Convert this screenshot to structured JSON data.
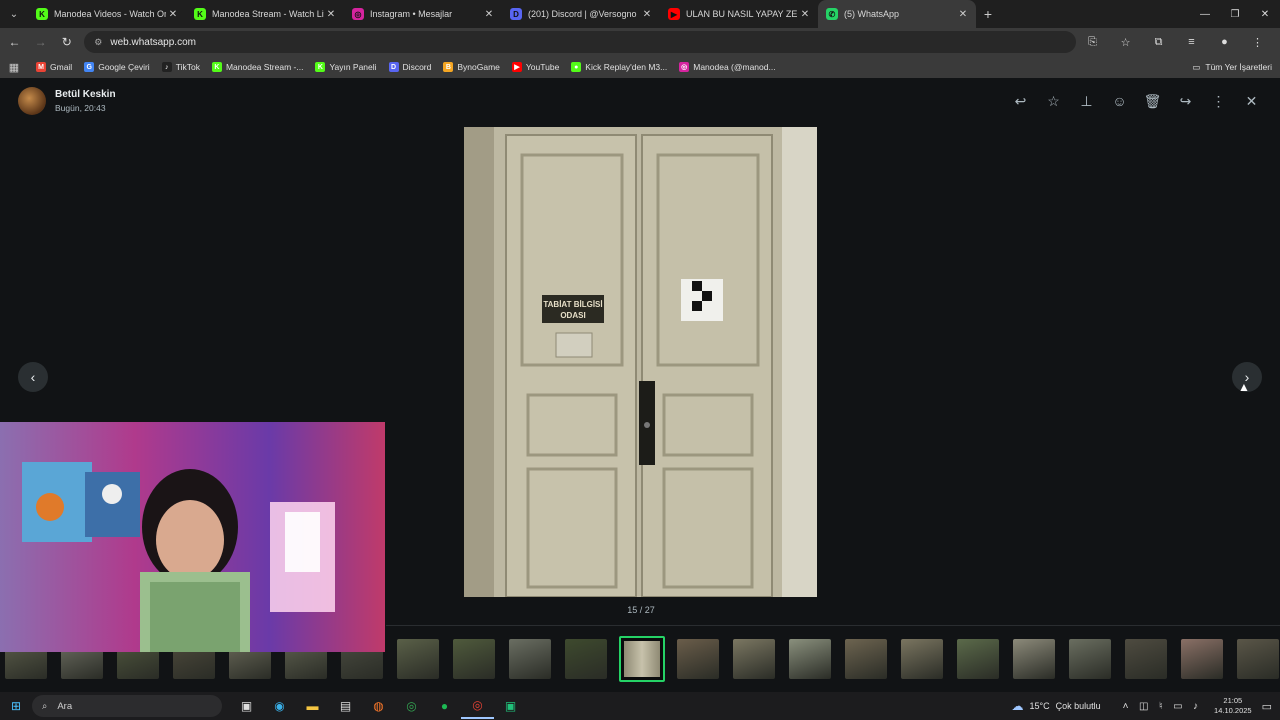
{
  "browser": {
    "tabs": [
      {
        "title": "Manodea Videos - Watch On-D",
        "icon": "kick-icon",
        "color": "#53fc18",
        "glyph": "K"
      },
      {
        "title": "Manodea Stream - Watch Live",
        "icon": "kick-icon",
        "color": "#53fc18",
        "glyph": "K"
      },
      {
        "title": "Instagram • Mesajlar",
        "icon": "instagram-icon",
        "color": "#d6249f",
        "glyph": "◎"
      },
      {
        "title": "(201) Discord | @Versogno",
        "icon": "discord-icon",
        "color": "#5865f2",
        "glyph": "D"
      },
      {
        "title": "ULAN BU NASIL YAPAY ZEKA - Y",
        "icon": "youtube-icon",
        "color": "#ff0000",
        "glyph": "▶"
      },
      {
        "title": "(5) WhatsApp",
        "icon": "whatsapp-icon",
        "color": "#25d366",
        "glyph": "✆"
      }
    ],
    "url": "web.whatsapp.com",
    "bookmarks": [
      {
        "label": "Gmail",
        "icon": "gmail-icon",
        "color": "#ea4335",
        "glyph": "M"
      },
      {
        "label": "Google Çeviri",
        "icon": "google-translate-icon",
        "color": "#4285f4",
        "glyph": "G"
      },
      {
        "label": "TikTok",
        "icon": "tiktok-icon",
        "color": "#222222",
        "glyph": "♪"
      },
      {
        "label": "Manodea Stream -...",
        "icon": "kick-icon",
        "color": "#53fc18",
        "glyph": "K"
      },
      {
        "label": "Yayın Paneli",
        "icon": "kick-icon",
        "color": "#53fc18",
        "glyph": "K"
      },
      {
        "label": "Discord",
        "icon": "discord-icon",
        "color": "#5865f2",
        "glyph": "D"
      },
      {
        "label": "BynoGame",
        "icon": "bynogame-icon",
        "color": "#f5a623",
        "glyph": "B"
      },
      {
        "label": "YouTube",
        "icon": "youtube-icon",
        "color": "#ff0000",
        "glyph": "▶"
      },
      {
        "label": "Kick Replay'den M3...",
        "icon": "kick-replay-icon",
        "color": "#53fc18",
        "glyph": "●"
      },
      {
        "label": "Manodea (@manod...",
        "icon": "instagram-icon",
        "color": "#d6249f",
        "glyph": "◎"
      }
    ],
    "all_bookmarks": "Tüm Yer İşaretleri"
  },
  "viewer": {
    "sender_name": "Betül Keskin",
    "sent_time": "Bugün, 20:43",
    "counter": "15 / 27",
    "door_sign_line1": "TABİAT BİLGİSİ",
    "door_sign_line2": "ODASI",
    "toolbar": [
      "reply-icon",
      "star-icon",
      "pin-icon",
      "emoji-icon",
      "delete-icon",
      "forward-icon",
      "menu-icon",
      "close-icon"
    ],
    "thumb_colors": [
      "#5b5d4a",
      "#6e6f63",
      "#50573e",
      "#4e4a3c",
      "#6b6a5a",
      "#5f6150",
      "#494b40",
      "#5a6048",
      "#4f5a3c",
      "#6a6e62",
      "#3e4a2e",
      "#9a9784",
      "#6a5d4a",
      "#7b7762",
      "#8a907d",
      "#6d6450",
      "#7a7560",
      "#5b6a4a",
      "#8c8a7a",
      "#6a6e60",
      "#4e4b40",
      "#8a7066",
      "#5a5648"
    ],
    "selected_thumb": 11
  },
  "taskbar": {
    "search_placeholder": "Ara",
    "weather_temp": "15°C",
    "weather_desc": "Çok bulutlu",
    "time": "21:05",
    "date": "14.10.2025"
  }
}
